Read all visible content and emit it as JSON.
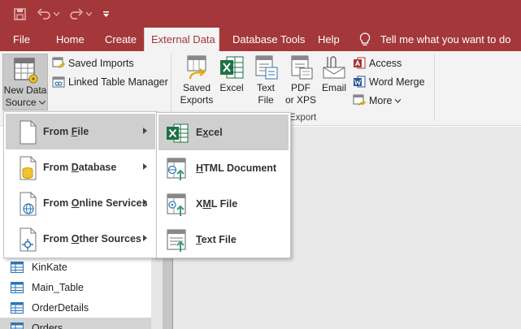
{
  "quick_access": {
    "icons": [
      "save-icon",
      "undo-icon",
      "redo-icon",
      "customize-qat-icon"
    ]
  },
  "tabs": [
    {
      "label": "File"
    },
    {
      "label": "Home"
    },
    {
      "label": "Create"
    },
    {
      "label": "External Data",
      "active": true
    },
    {
      "label": "Database Tools"
    },
    {
      "label": "Help"
    }
  ],
  "tell_me": "Tell me what you want to do",
  "ribbon": {
    "new_data_source": {
      "line1": "New Data",
      "line2": "Source"
    },
    "import_group": {
      "saved_imports": "Saved Imports",
      "linked_table_manager": "Linked Table Manager"
    },
    "export_group": {
      "label": "Export",
      "saved_exports": {
        "line1": "Saved",
        "line2": "Exports"
      },
      "excel": "Excel",
      "text_file": {
        "line1": "Text",
        "line2": "File"
      },
      "pdf_xps": {
        "line1": "PDF",
        "line2": "or XPS"
      },
      "email": "Email",
      "access": "Access",
      "word_merge": "Word Merge",
      "more": "More"
    }
  },
  "new_data_source_menu": [
    {
      "prefix": "From ",
      "key": "F",
      "rest": "ile",
      "highlighted": true
    },
    {
      "prefix": "From ",
      "key": "D",
      "rest": "atabase"
    },
    {
      "prefix": "From ",
      "key": "O",
      "rest": "nline Services"
    },
    {
      "prefix": "From ",
      "key": "O",
      "rest": "ther Sources"
    }
  ],
  "from_file_submenu": [
    {
      "prefix": "E",
      "key": "x",
      "rest": "cel",
      "highlighted": true
    },
    {
      "prefix": "",
      "key": "H",
      "rest": "TML Document"
    },
    {
      "prefix": "X",
      "key": "M",
      "rest": "L File"
    },
    {
      "prefix": "",
      "key": "T",
      "rest": "ext File"
    }
  ],
  "nav_pane": {
    "tables": [
      "KinKate",
      "Main_Table",
      "OrderDetails",
      "Orders"
    ],
    "selected": "Orders"
  },
  "colors": {
    "brand": "#a4373a",
    "ribbon_bg": "#f3f3f3",
    "menu_highlight": "#cfcfcf",
    "excel_green": "#1e7145",
    "access_red": "#a4373a"
  }
}
